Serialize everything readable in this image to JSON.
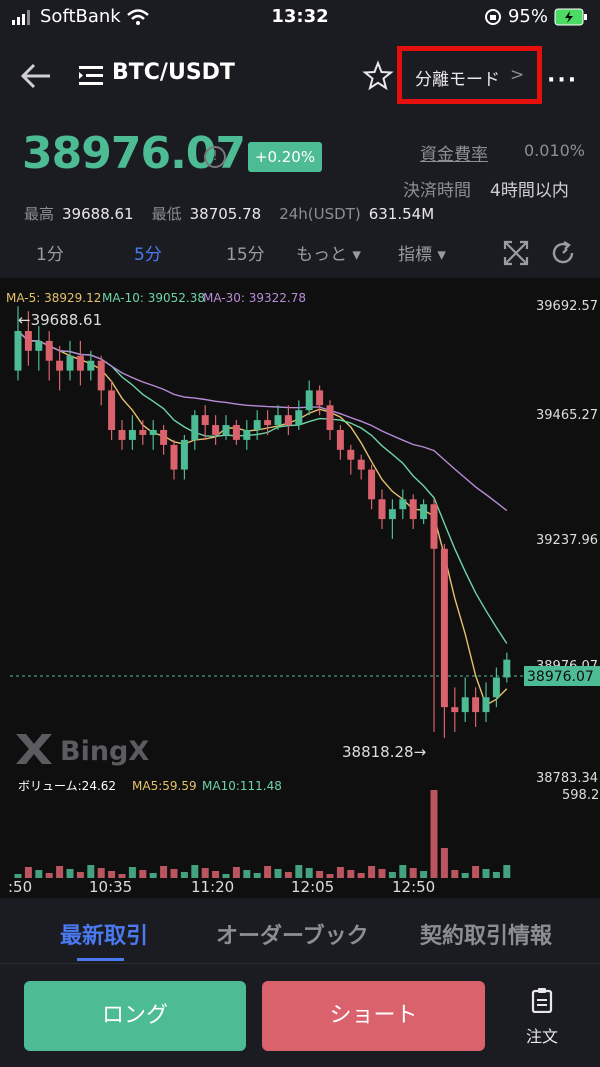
{
  "status": {
    "carrier": "SoftBank",
    "time": "13:32",
    "battery": "95%"
  },
  "header": {
    "pair": "BTC/USDT",
    "mode": "分離モード",
    "mode_chevron": ">",
    "more": "···"
  },
  "ticker": {
    "price": "38976.07",
    "change": "+0.20%",
    "funding_label": "資金費率",
    "funding_value": "0.010%",
    "settle_label": "決済時間",
    "settle_value": "4時間以内",
    "high_label": "最高",
    "high_value": "39688.61",
    "low_label": "最低",
    "low_value": "38705.78",
    "vol_label": "24h(USDT)",
    "vol_value": "631.54M"
  },
  "intervals": {
    "i1": "1分",
    "i5": "5分",
    "i15": "15分",
    "more": "もっと ▾",
    "indicator": "指標 ▾"
  },
  "chart": {
    "ma5_label": "MA-5: 38929.12",
    "ma10_label": "MA-10: 39052.38",
    "ma30_label": "MA-30: 39322.78",
    "high_marker": "←39688.61",
    "low_marker": "38818.28→",
    "current_price_tag": "38976.07",
    "right_axis_ticks": [
      "39692.57",
      "39465.27",
      "39237.96",
      "38783.34"
    ],
    "hidden_tick": "38976.07",
    "volume_axis": "598.2",
    "volume_label": "ボリューム:24.62",
    "vol_ma5_label": "MA5:59.59",
    "vol_ma10_label": "MA10:111.48",
    "time_ticks": [
      ":50",
      "10:35",
      "11:20",
      "12:05",
      "12:50"
    ],
    "watermark": "BingX",
    "colors": {
      "up": "#4dbb94",
      "down": "#d9626d",
      "ma5": "#e5c16b",
      "ma10": "#6dd4a4",
      "ma30": "#b88bd6"
    }
  },
  "chart_data": {
    "type": "line",
    "title": "",
    "xlabel": "",
    "ylabel": "",
    "x": [
      ":50",
      "10:35",
      "11:20",
      "12:05",
      "12:50"
    ],
    "ylim": [
      38783.34,
      39692.57
    ],
    "series": [
      {
        "name": "MA-5",
        "values": [
          39620,
          39350,
          39470,
          39490,
          38950
        ]
      },
      {
        "name": "MA-10",
        "values": [
          39560,
          39460,
          39450,
          39475,
          39100
        ]
      },
      {
        "name": "MA-30",
        "values": [
          39400,
          39460,
          39480,
          39450,
          39330
        ]
      }
    ]
  },
  "tabs": {
    "latest": "最新取引",
    "orderbook": "オーダーブック",
    "contract": "契約取引情報"
  },
  "actions": {
    "long": "ロング",
    "short": "ショート",
    "order": "注文"
  }
}
